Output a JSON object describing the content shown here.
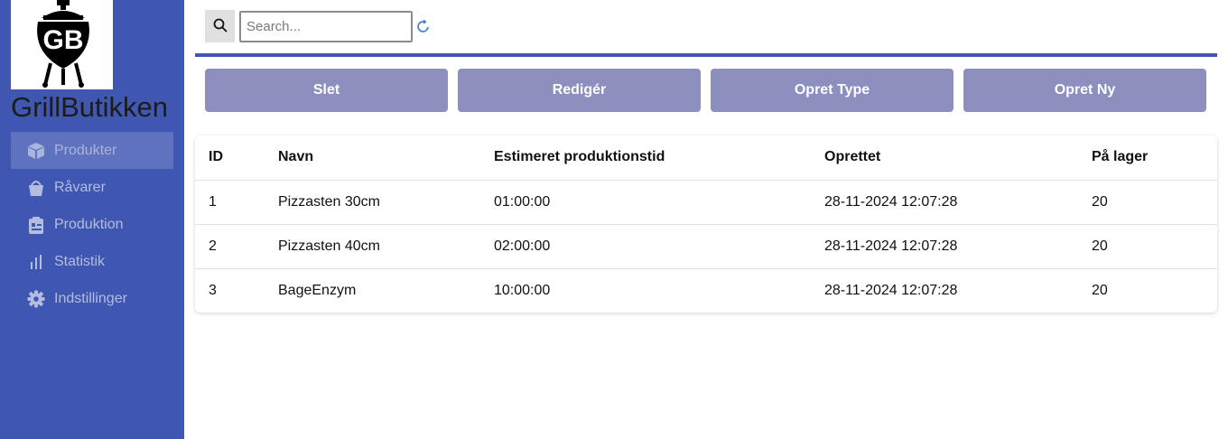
{
  "app": {
    "brand": "GrillButikken",
    "logo_text": "GB",
    "accent_color": "#3f57b0",
    "button_color": "#8d90bf"
  },
  "sidebar": {
    "items": [
      {
        "label": "Produkter",
        "icon": "box-icon",
        "active": true
      },
      {
        "label": "Råvarer",
        "icon": "bucket-icon",
        "active": false
      },
      {
        "label": "Produktion",
        "icon": "clipboard-icon",
        "active": false
      },
      {
        "label": "Statistik",
        "icon": "bar-chart-icon",
        "active": false
      },
      {
        "label": "Indstillinger",
        "icon": "gear-icon",
        "active": false
      }
    ]
  },
  "search": {
    "placeholder": "Search...",
    "value": ""
  },
  "toolbar": {
    "delete_label": "Slet",
    "edit_label": "Redigér",
    "create_type_label": "Opret Type",
    "create_new_label": "Opret Ny"
  },
  "table": {
    "headers": [
      "ID",
      "Navn",
      "Estimeret produktionstid",
      "Oprettet",
      "På lager"
    ],
    "rows": [
      [
        "1",
        "Pizzasten 30cm",
        "01:00:00",
        "28-11-2024 12:07:28",
        "20"
      ],
      [
        "2",
        "Pizzasten 40cm",
        "02:00:00",
        "28-11-2024 12:07:28",
        "20"
      ],
      [
        "3",
        "BageEnzym",
        "10:00:00",
        "28-11-2024 12:07:28",
        "20"
      ]
    ]
  }
}
